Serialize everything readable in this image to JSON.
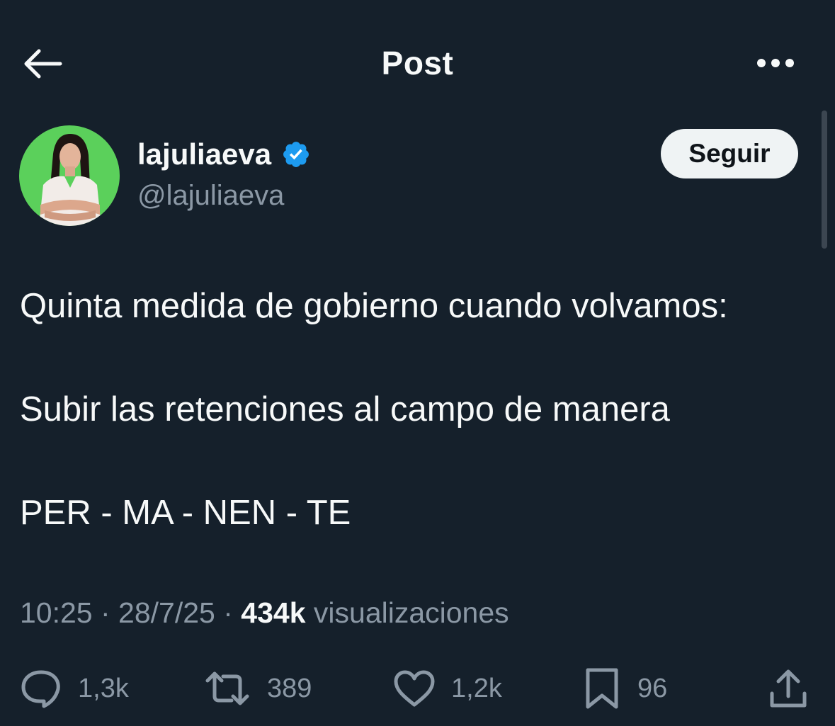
{
  "header": {
    "title": "Post"
  },
  "author": {
    "display_name": "lajuliaeva",
    "handle": "@lajuliaeva",
    "verified": true,
    "avatar_bg": "#5bd05b"
  },
  "follow_button": {
    "label": "Seguir"
  },
  "post": {
    "lines": [
      "Quinta medida de gobierno cuando volvamos:",
      "Subir las retenciones al campo de manera",
      "PER - MA - NEN - TE"
    ]
  },
  "meta": {
    "time": "10:25",
    "separator": " · ",
    "date": "28/7/25",
    "views_count": "434k",
    "views_label": "visualizaciones"
  },
  "actions": {
    "replies": "1,3k",
    "reposts": "389",
    "likes": "1,2k",
    "bookmarks": "96"
  },
  "colors": {
    "background": "#15202b",
    "text": "#f7f9f9",
    "secondary": "#8b98a5",
    "verified": "#1d9bf0",
    "button_bg": "#eff3f4"
  }
}
